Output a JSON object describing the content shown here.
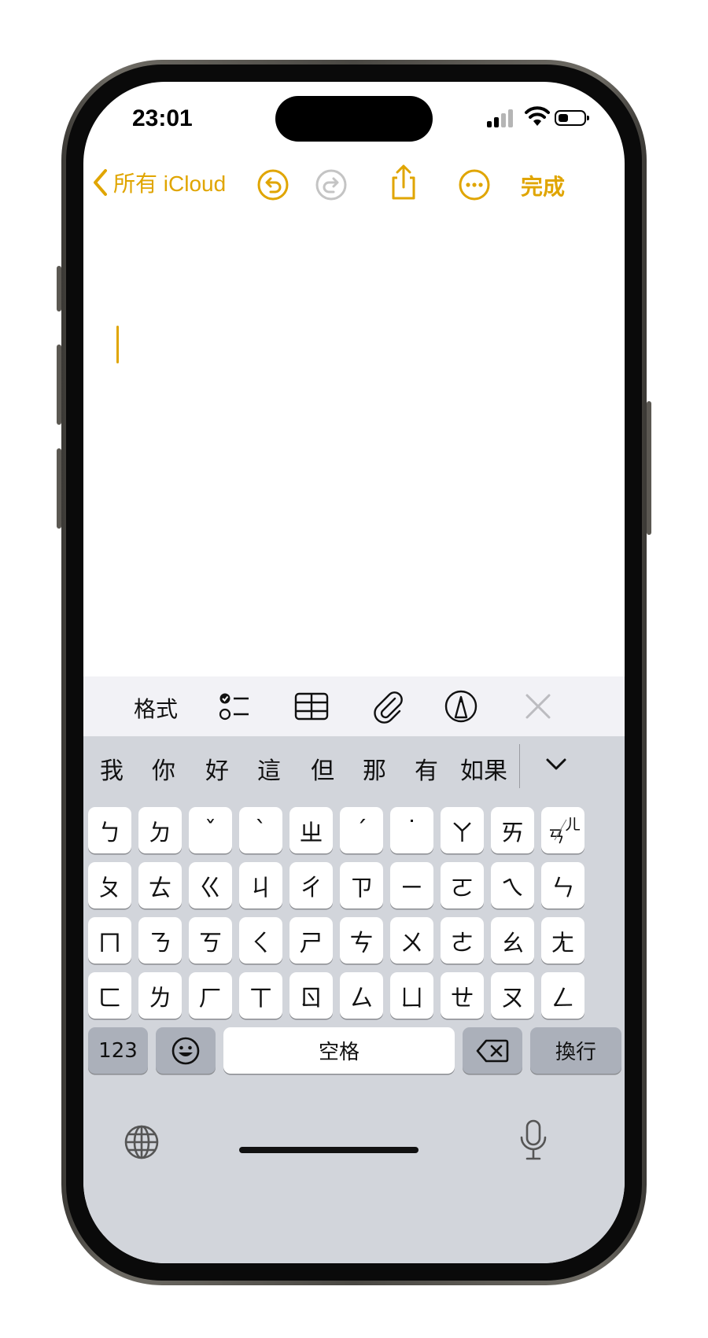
{
  "status": {
    "time": "23:01"
  },
  "navbar": {
    "back_label": "所有 iCloud",
    "undo_icon": "undo-icon",
    "redo_icon": "redo-icon",
    "share_icon": "share-icon",
    "more_icon": "more-icon",
    "done_label": "完成",
    "accent": "#E0A500"
  },
  "format_bar": {
    "format_label": "格式",
    "icons": [
      "checklist-icon",
      "table-icon",
      "paperclip-icon",
      "markup-icon",
      "close-icon"
    ]
  },
  "keyboard": {
    "candidates": [
      "我",
      "你",
      "好",
      "這",
      "但",
      "那",
      "有",
      "如果"
    ],
    "rows": [
      [
        "ㄅ",
        "ㄉ",
        "ˇ",
        "ˋ",
        "ㄓ",
        "ˊ",
        "˙",
        "ㄚ",
        "ㄞ",
        "ㄢ"
      ],
      [
        "ㄆ",
        "ㄊ",
        "ㄍ",
        "ㄐ",
        "ㄔ",
        "ㄗ",
        "ㄧ",
        "ㄛ",
        "ㄟ",
        "ㄣ"
      ],
      [
        "ㄇ",
        "ㄋ",
        "ㄎ",
        "ㄑ",
        "ㄕ",
        "ㄘ",
        "ㄨ",
        "ㄜ",
        "ㄠ",
        "ㄤ"
      ],
      [
        "ㄈ",
        "ㄌ",
        "ㄏ",
        "ㄒ",
        "ㄖ",
        "ㄙ",
        "ㄩ",
        "ㄝ",
        "ㄡ",
        "ㄥ"
      ]
    ],
    "extra_key_small": "ㄦ",
    "numbers_label": "123",
    "space_label": "空格",
    "return_label": "換行",
    "emoji_icon": "emoji-icon",
    "delete_icon": "delete-icon",
    "globe_icon": "globe-icon",
    "mic_icon": "microphone-icon"
  }
}
